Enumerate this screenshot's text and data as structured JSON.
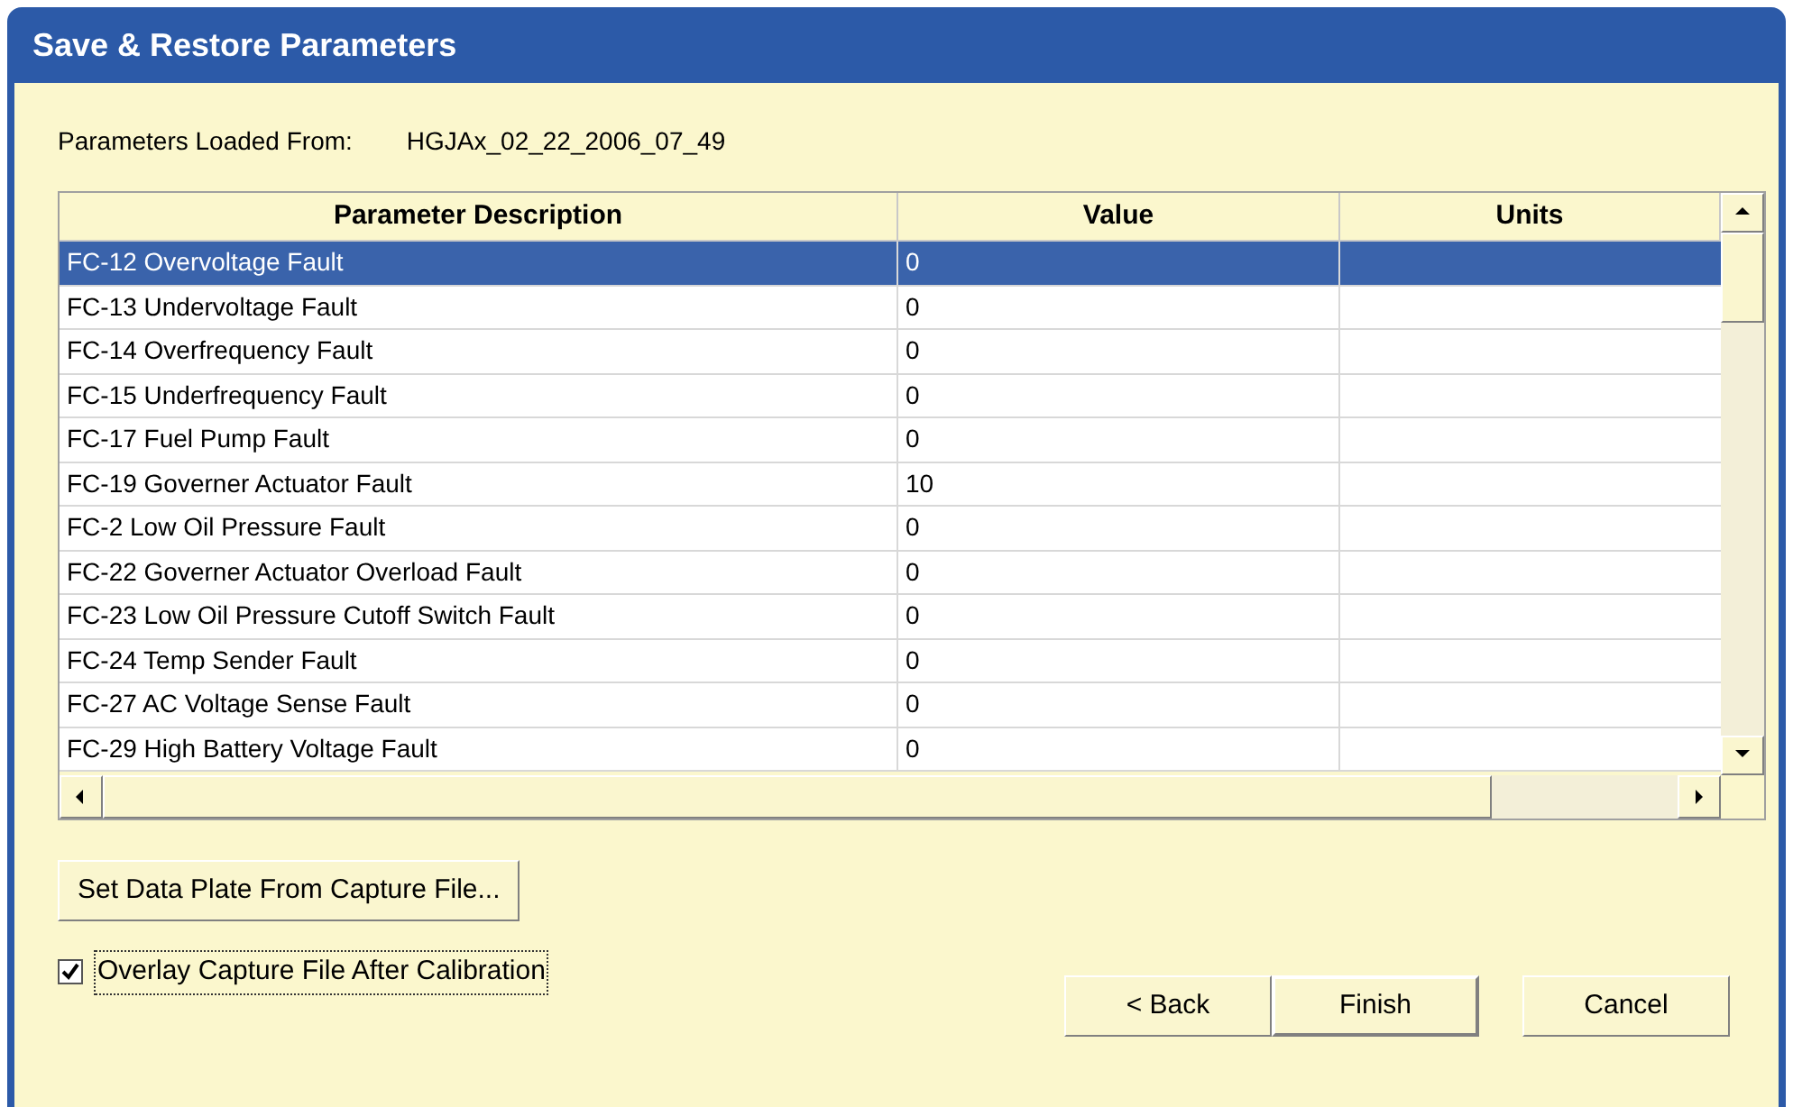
{
  "window": {
    "title": "Save & Restore Parameters"
  },
  "loaded_from": {
    "label": "Parameters Loaded From:",
    "value": "HGJAx_02_22_2006_07_49"
  },
  "table": {
    "columns": [
      "Parameter Description",
      "Value",
      "Units"
    ],
    "rows": [
      {
        "description": "FC-12 Overvoltage Fault",
        "value": "0",
        "selected": true
      },
      {
        "description": "FC-13 Undervoltage Fault",
        "value": "0",
        "selected": false
      },
      {
        "description": "FC-14 Overfrequency Fault",
        "value": "0",
        "selected": false
      },
      {
        "description": "FC-15 Underfrequency Fault",
        "value": "0",
        "selected": false
      },
      {
        "description": "FC-17 Fuel Pump Fault",
        "value": "0",
        "selected": false
      },
      {
        "description": "FC-19 Governer Actuator Fault",
        "value": "10",
        "selected": false
      },
      {
        "description": "FC-2 Low Oil Pressure Fault",
        "value": "0",
        "selected": false
      },
      {
        "description": "FC-22 Governer Actuator Overload Fault",
        "value": "0",
        "selected": false
      },
      {
        "description": "FC-23 Low Oil Pressure Cutoff Switch Fault",
        "value": "0",
        "selected": false
      },
      {
        "description": "FC-24 Temp Sender Fault",
        "value": "0",
        "selected": false
      },
      {
        "description": "FC-27 AC Voltage Sense Fault",
        "value": "0",
        "selected": false
      },
      {
        "description": "FC-29 High Battery Voltage Fault",
        "value": "0",
        "selected": false
      }
    ]
  },
  "data_plate_button": "Set Data Plate From Capture File...",
  "overlay_checkbox": {
    "label": "Overlay Capture File After Calibration",
    "checked": true
  },
  "buttons": [
    "< Back",
    "Finish",
    "Cancel"
  ]
}
